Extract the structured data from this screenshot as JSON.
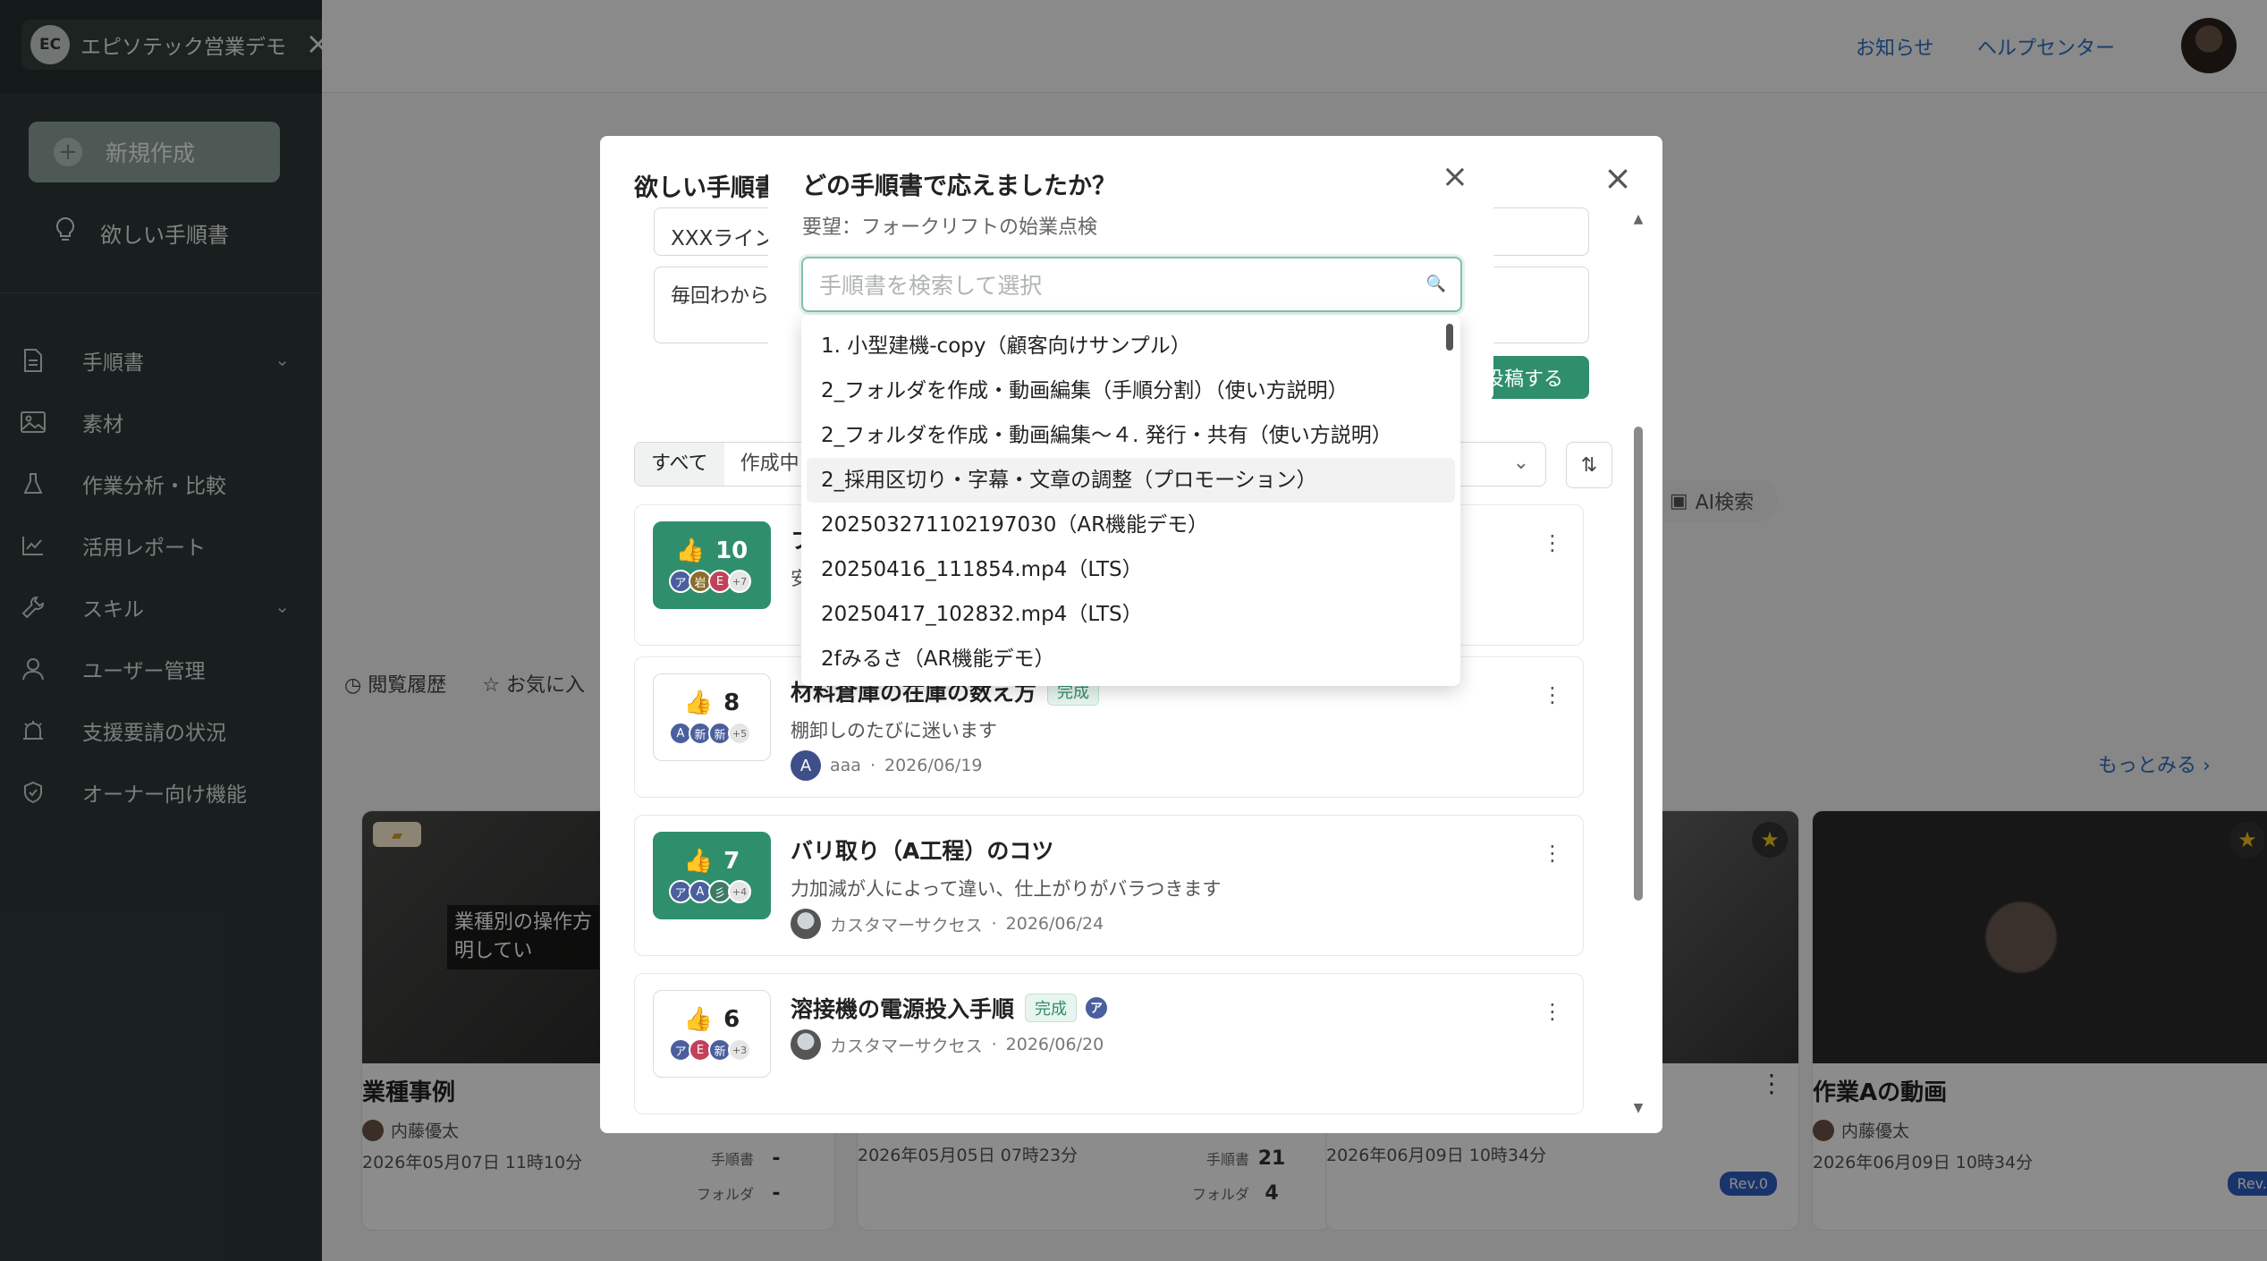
{
  "app": {
    "brand_name": "エピソテック営業デモ",
    "brand_logo_text": "EC"
  },
  "sidebar": {
    "new_button": "新規作成",
    "wish_button": "欲しい手順書",
    "items": [
      {
        "label": "手順書",
        "icon": "document-icon",
        "expandable": true
      },
      {
        "label": "素材",
        "icon": "image-icon",
        "expandable": false
      },
      {
        "label": "作業分析・比較",
        "icon": "flask-icon",
        "expandable": false
      },
      {
        "label": "活用レポート",
        "icon": "chart-line-icon",
        "expandable": false
      },
      {
        "label": "スキル",
        "icon": "wrench-icon",
        "expandable": true
      },
      {
        "label": "ユーザー管理",
        "icon": "user-icon",
        "expandable": false
      },
      {
        "label": "支援要請の状況",
        "icon": "alarm-icon",
        "expandable": false
      },
      {
        "label": "オーナー向け機能",
        "icon": "shield-icon",
        "expandable": false
      }
    ]
  },
  "topbar": {
    "notice": "お知らせ",
    "help": "ヘルプセンター"
  },
  "background": {
    "tab_history": "閲覧履歴",
    "tab_favorites": "お気に入",
    "more_link": "もっとみる",
    "ai_search": "AI検索",
    "cards": [
      {
        "title": "業種事例",
        "author": "内藤優太",
        "date": "2026年05月07日 11時10分",
        "stat_manual_label": "手順書",
        "stat_manual": "-",
        "stat_folder_label": "フォルダ",
        "stat_folder": "-",
        "thumb_text": "業種別の操作方\n明してい"
      },
      {
        "title": "",
        "author": "",
        "date": "2026年05月05日 07時23分",
        "stat_manual_label": "手順書",
        "stat_manual": "21",
        "stat_folder_label": "フォルダ",
        "stat_folder": "4"
      },
      {
        "title": "",
        "author": "",
        "date": "2026年06月09日 10時34分",
        "rev": "Rev.0"
      },
      {
        "title": "作業Aの動画",
        "author": "内藤優太",
        "date": "2026年06月09日 10時34分",
        "rev": "Rev."
      }
    ]
  },
  "request_modal": {
    "title": "欲しい手順書",
    "field_title_value": "XXXライン",
    "field_desc_value": "毎回わから",
    "post_button": "投稿する",
    "filters": [
      "すべて",
      "作成中"
    ],
    "requests": [
      {
        "votes": "10",
        "voted": true,
        "title": "フ",
        "desc": "安",
        "author": "",
        "date": "",
        "voters": [
          "ア",
          "岩",
          "E"
        ],
        "more": "+7",
        "done": false
      },
      {
        "votes": "8",
        "voted": false,
        "title": "材料倉庫の在庫の数え方",
        "desc": "棚卸しのたびに迷います",
        "author": "aaa",
        "author_initial": "A",
        "date": "2026/06/19",
        "voters": [
          "A",
          "新",
          "新"
        ],
        "more": "+5",
        "done": true,
        "done_label": "完成"
      },
      {
        "votes": "7",
        "voted": true,
        "title": "バリ取り（A工程）のコツ",
        "desc": "力加減が人によって違い、仕上がりがバラつきます",
        "author": "カスタマーサクセス",
        "date": "2026/06/24",
        "voters": [
          "ア",
          "A",
          "彡"
        ],
        "more": "+4",
        "done": false
      },
      {
        "votes": "6",
        "voted": false,
        "title": "溶接機の電源投入手順",
        "desc": "",
        "author": "カスタマーサクセス",
        "date": "2026/06/20",
        "voters": [
          "ア",
          "E",
          "新"
        ],
        "more": "+3",
        "done": true,
        "done_label": "完成",
        "done_avatar": "ア"
      }
    ]
  },
  "picker_modal": {
    "title": "どの手順書で応えましたか？",
    "subtitle": "要望：フォークリフトの始業点検",
    "search_placeholder": "手順書を検索して選択",
    "options": [
      "1. 小型建機-copy（顧客向けサンプル）",
      "2_フォルダを作成・動画編集（手順分割）（使い方説明）",
      "2_フォルダを作成・動画編集〜４. 発行・共有（使い方説明）",
      "2_採用区切り・字幕・文章の調整（プロモーション）",
      "202503271102197030（AR機能デモ）",
      "20250416_111854.mp4（LTS）",
      "20250417_102832.mp4（LTS）",
      "2fみるさ（AR機能デモ）"
    ],
    "hovered_index": 3
  }
}
